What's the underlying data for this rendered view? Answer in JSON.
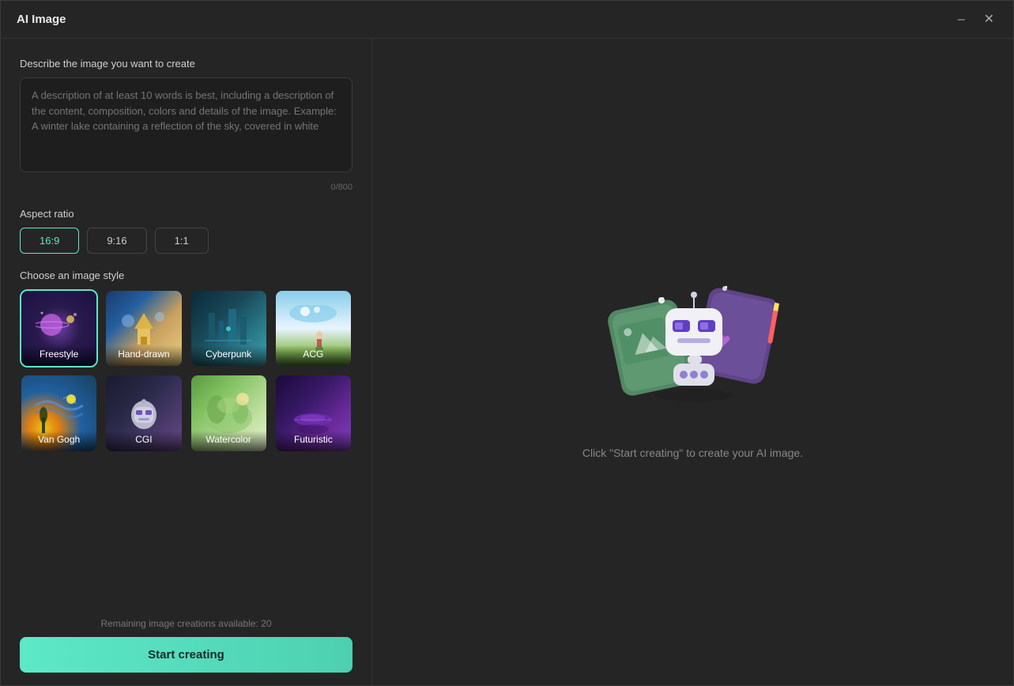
{
  "window": {
    "title": "AI Image"
  },
  "titleBar": {
    "title": "AI Image",
    "minimizeLabel": "minimize",
    "closeLabel": "close"
  },
  "leftPanel": {
    "descriptionLabel": "Describe the image you want to create",
    "descriptionPlaceholder": "A description of at least 10 words is best, including a description of the content, composition, colors and details of the image. Example: A winter lake containing a reflection of the sky, covered in white",
    "charCount": "0/800",
    "aspectRatioLabel": "Aspect ratio",
    "aspectRatios": [
      {
        "label": "16:9",
        "active": true
      },
      {
        "label": "9:16",
        "active": false
      },
      {
        "label": "1:1",
        "active": false
      }
    ],
    "styleLabel": "Choose an image style",
    "styles": [
      {
        "label": "Freestyle",
        "active": true,
        "bg": "freestyle"
      },
      {
        "label": "Hand-drawn",
        "active": false,
        "bg": "handdrawn"
      },
      {
        "label": "Cyberpunk",
        "active": false,
        "bg": "cyberpunk"
      },
      {
        "label": "ACG",
        "active": false,
        "bg": "acg"
      },
      {
        "label": "Van Gogh",
        "active": false,
        "bg": "vangogh"
      },
      {
        "label": "CGI",
        "active": false,
        "bg": "cgi"
      },
      {
        "label": "Watercolor",
        "active": false,
        "bg": "watercolor"
      },
      {
        "label": "Futuristic",
        "active": false,
        "bg": "futuristic"
      }
    ],
    "remainingText": "Remaining image creations available: 20",
    "startButtonLabel": "Start creating"
  },
  "rightPanel": {
    "hintText": "Click \"Start creating\" to create your AI image."
  }
}
